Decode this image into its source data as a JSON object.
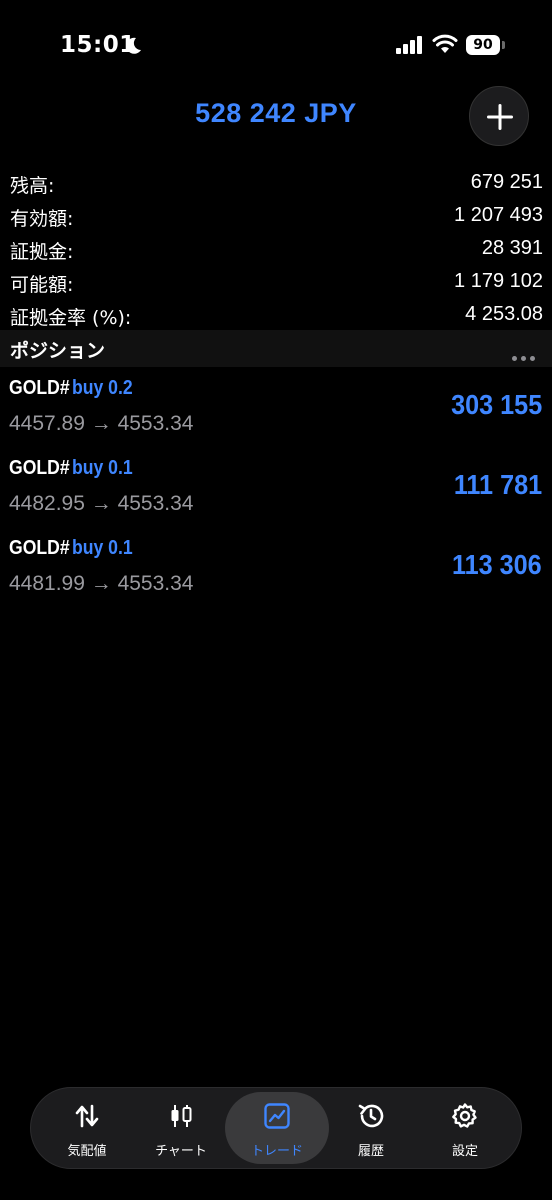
{
  "status_bar": {
    "time": "15:01",
    "battery": "90"
  },
  "header": {
    "balance_title": "528 242 JPY",
    "add_icon": "plus-icon"
  },
  "summary": [
    {
      "label": "残高:",
      "value": "679 251"
    },
    {
      "label": "有効額:",
      "value": "1 207 493"
    },
    {
      "label": "証拠金:",
      "value": "28 391"
    },
    {
      "label": "可能額:",
      "value": "1 179 102"
    },
    {
      "label": "証拠金率 (%):",
      "value": "4 253.08"
    }
  ],
  "positions_section": {
    "title": "ポジション",
    "items": [
      {
        "symbol": "GOLD#",
        "side": "buy 0.2",
        "prices": "4457.89 → 4553.34",
        "profit": "303 155"
      },
      {
        "symbol": "GOLD#",
        "side": "buy 0.1",
        "prices": "4482.95 → 4553.34",
        "profit": "111 781"
      },
      {
        "symbol": "GOLD#",
        "side": "buy 0.1",
        "prices": "4481.99 → 4553.34",
        "profit": "113 306"
      }
    ]
  },
  "tab_bar": {
    "tabs": [
      {
        "label": "気配値",
        "icon": "arrows-up-down-icon"
      },
      {
        "label": "チャート",
        "icon": "candlestick-icon"
      },
      {
        "label": "トレード",
        "icon": "trend-chart-icon",
        "active": true
      },
      {
        "label": "履歴",
        "icon": "history-icon"
      },
      {
        "label": "設定",
        "icon": "gear-icon"
      }
    ]
  },
  "colors": {
    "accent": "#3f86ff",
    "background": "#000000",
    "secondary_text": "#9a9a9f"
  }
}
